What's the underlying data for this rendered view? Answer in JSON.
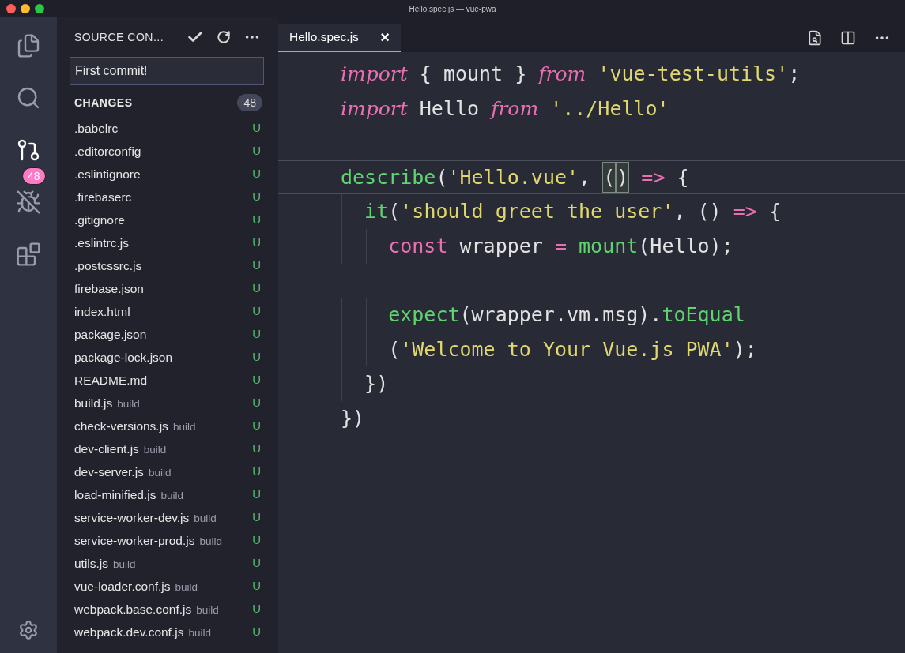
{
  "window": {
    "title": "Hello.spec.js — vue-pwa"
  },
  "activity_bar": {
    "items": [
      {
        "kind": "files",
        "selected": false
      },
      {
        "kind": "search",
        "selected": false
      },
      {
        "kind": "source-control",
        "selected": true,
        "badge": "48"
      },
      {
        "kind": "debug",
        "selected": false
      },
      {
        "kind": "extensions",
        "selected": false
      }
    ]
  },
  "sidebar": {
    "title": "SOURCE CON...",
    "commit_message": "First commit!",
    "section": {
      "title": "CHANGES",
      "count": "48"
    },
    "files": [
      {
        "name": ".babelrc",
        "status": "U"
      },
      {
        "name": ".editorconfig",
        "status": "U"
      },
      {
        "name": ".eslintignore",
        "status": "U"
      },
      {
        "name": ".firebaserc",
        "status": "U"
      },
      {
        "name": ".gitignore",
        "status": "U"
      },
      {
        "name": ".eslintrc.js",
        "status": "U"
      },
      {
        "name": ".postcssrc.js",
        "status": "U"
      },
      {
        "name": "firebase.json",
        "status": "U"
      },
      {
        "name": "index.html",
        "status": "U"
      },
      {
        "name": "package.json",
        "status": "U"
      },
      {
        "name": "package-lock.json",
        "status": "U"
      },
      {
        "name": "README.md",
        "status": "U"
      },
      {
        "name": "build.js",
        "folder": "build",
        "status": "U"
      },
      {
        "name": "check-versions.js",
        "folder": "build",
        "status": "U"
      },
      {
        "name": "dev-client.js",
        "folder": "build",
        "status": "U"
      },
      {
        "name": "dev-server.js",
        "folder": "build",
        "status": "U"
      },
      {
        "name": "load-minified.js",
        "folder": "build",
        "status": "U"
      },
      {
        "name": "service-worker-dev.js",
        "folder": "build",
        "status": "U"
      },
      {
        "name": "service-worker-prod.js",
        "folder": "build",
        "status": "U"
      },
      {
        "name": "utils.js",
        "folder": "build",
        "status": "U"
      },
      {
        "name": "vue-loader.conf.js",
        "folder": "build",
        "status": "U"
      },
      {
        "name": "webpack.base.conf.js",
        "folder": "build",
        "status": "U"
      },
      {
        "name": "webpack.dev.conf.js",
        "folder": "build",
        "status": "U"
      }
    ]
  },
  "tabs": [
    {
      "label": "Hello.spec.js",
      "selected": true,
      "close": "×"
    }
  ],
  "editor": {
    "lines": [
      {
        "current": false,
        "tokens": [
          {
            "kind": "keyword",
            "text": "import"
          },
          {
            "kind": "plain",
            "text": " { mount } "
          },
          {
            "kind": "keyword",
            "text": "from"
          },
          {
            "kind": "string",
            "text": " 'vue-test-utils'"
          },
          {
            "kind": "plain",
            "text": ";"
          }
        ]
      },
      {
        "current": false,
        "tokens": [
          {
            "kind": "keyword",
            "text": "import"
          },
          {
            "kind": "plain",
            "text": " Hello "
          },
          {
            "kind": "keyword",
            "text": "from"
          },
          {
            "kind": "string",
            "text": " '../Hello'"
          }
        ]
      },
      {
        "current": false
      },
      {
        "current": true,
        "tokens": [
          {
            "kind": "function",
            "text": "describe"
          },
          {
            "kind": "plain",
            "text": "("
          },
          {
            "kind": "string",
            "text": "'Hello.vue'"
          },
          {
            "kind": "plain",
            "text": ", "
          },
          {
            "kind": "match",
            "text": "("
          },
          {
            "kind": "match",
            "text": ")"
          },
          {
            "kind": "operator",
            "text": " => "
          },
          {
            "kind": "plain",
            "text": "{"
          }
        ]
      },
      {
        "current": false,
        "tokens": [
          {
            "kind": "function",
            "text": "  it"
          },
          {
            "kind": "plain",
            "text": "("
          },
          {
            "kind": "string",
            "text": "'should greet the user'"
          },
          {
            "kind": "plain",
            "text": ", () "
          },
          {
            "kind": "operator",
            "text": "=>"
          },
          {
            "kind": "plain",
            "text": " {"
          }
        ]
      },
      {
        "current": false,
        "tokens": [
          {
            "kind": "storage",
            "text": "    const"
          },
          {
            "kind": "plain",
            "text": " wrapper "
          },
          {
            "kind": "operator",
            "text": "="
          },
          {
            "kind": "function",
            "text": " mount"
          },
          {
            "kind": "plain",
            "text": "(Hello);"
          }
        ]
      },
      {
        "current": false
      },
      {
        "current": false,
        "tokens": [
          {
            "kind": "function",
            "text": "    expect"
          },
          {
            "kind": "plain",
            "text": "(wrapper.vm.msg)."
          },
          {
            "kind": "function",
            "text": "toEqual"
          }
        ]
      },
      {
        "current": false,
        "tokens": [
          {
            "kind": "plain",
            "text": "    ("
          },
          {
            "kind": "string",
            "text": "'Welcome to Your Vue.js PWA'"
          },
          {
            "kind": "plain",
            "text": ");"
          }
        ]
      },
      {
        "current": false,
        "tokens": [
          {
            "kind": "plain",
            "text": "  })"
          }
        ]
      },
      {
        "current": false,
        "tokens": [
          {
            "kind": "plain",
            "text": "})"
          }
        ]
      }
    ]
  }
}
